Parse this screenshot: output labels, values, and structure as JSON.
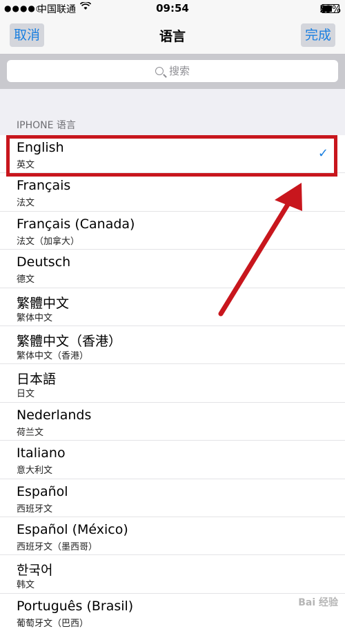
{
  "status_bar": {
    "signal": "●●●●○",
    "carrier": "中国联通",
    "wifi_icon": "wifi-icon",
    "time": "09:54",
    "battery_percent": "53%"
  },
  "nav": {
    "cancel": "取消",
    "title": "语言",
    "done": "完成"
  },
  "search": {
    "placeholder": "搜索"
  },
  "section_header": "IPHONE 语言",
  "languages": [
    {
      "name": "English",
      "sub": "英文",
      "selected": true
    },
    {
      "name": "Français",
      "sub": "法文"
    },
    {
      "name": "Français (Canada)",
      "sub": "法文（加拿大）"
    },
    {
      "name": "Deutsch",
      "sub": "德文"
    },
    {
      "name": "繁體中文",
      "sub": "繁体中文"
    },
    {
      "name": "繁體中文（香港）",
      "sub": "繁体中文（香港）"
    },
    {
      "name": "日本語",
      "sub": "日文"
    },
    {
      "name": "Nederlands",
      "sub": "荷兰文"
    },
    {
      "name": "Italiano",
      "sub": "意大利文"
    },
    {
      "name": "Español",
      "sub": "西班牙文"
    },
    {
      "name": "Español (México)",
      "sub": "西班牙文（墨西哥）"
    },
    {
      "name": "한국어",
      "sub": "韩文"
    },
    {
      "name": "Português (Brasil)",
      "sub": "葡萄牙文（巴西）"
    }
  ],
  "checkmark": "✓",
  "colors": {
    "accent": "#1a7fe0",
    "annotation": "#c8161d"
  },
  "watermark": "Bai 经验"
}
